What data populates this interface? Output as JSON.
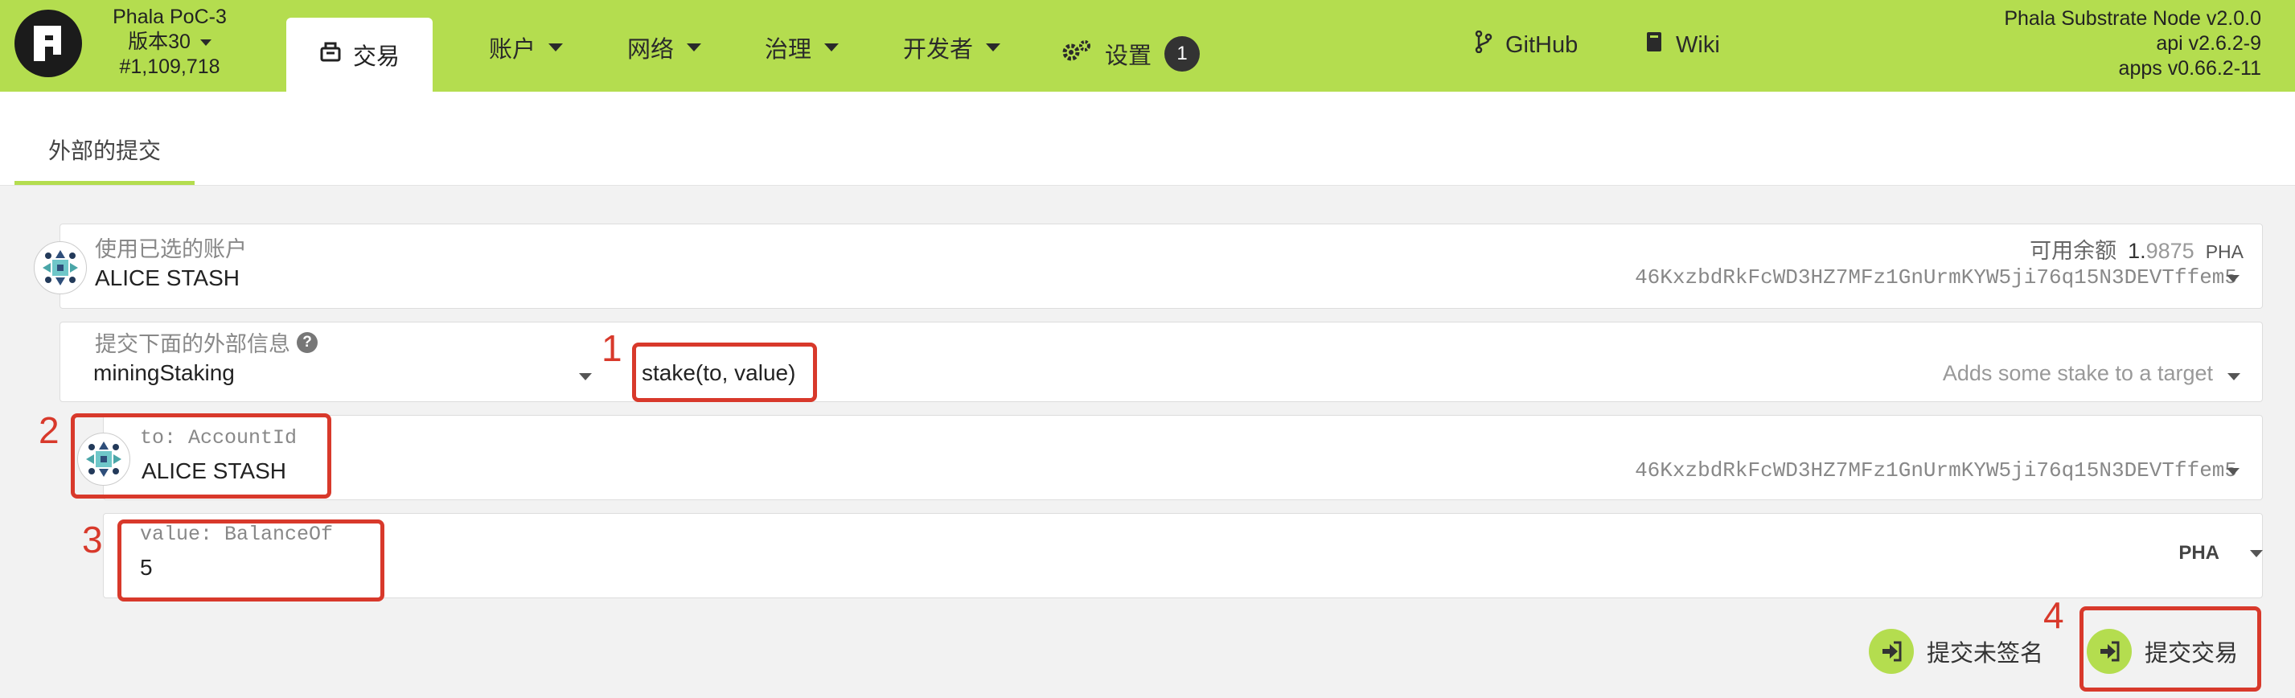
{
  "nav": {
    "chain_name": "Phala PoC-3",
    "chain_version": "版本30",
    "block_number": "#1,109,718",
    "active_tab": "交易",
    "menu": [
      {
        "label": "账户"
      },
      {
        "label": "网络"
      },
      {
        "label": "治理"
      },
      {
        "label": "开发者"
      }
    ],
    "settings_label": "设置",
    "settings_badge": "1",
    "github_label": "GitHub",
    "wiki_label": "Wiki",
    "node_name": "Phala Substrate Node v2.0.0",
    "api_version": "api v2.6.2-9",
    "apps_version": "apps v0.66.2-11",
    "accent_color": "#b4dd4f"
  },
  "subnav": {
    "tab_label": "外部的提交"
  },
  "account": {
    "label": "使用已选的账户",
    "name": "ALICE STASH",
    "balance_label": "可用余额",
    "balance_int": "1.",
    "balance_dec": "9875",
    "balance_unit": "PHA",
    "address": "46KxzbdRkFcWD3HZ7MFz1GnUrmKYW5ji76q15N3DEVTffem5"
  },
  "extrinsic": {
    "label": "提交下面的外部信息",
    "module": "miningStaking",
    "method": "stake(to, value)",
    "method_desc": "Adds some stake to a target"
  },
  "param_to": {
    "label": "to: AccountId",
    "name": "ALICE STASH",
    "address": "46KxzbdRkFcWD3HZ7MFz1GnUrmKYW5ji76q15N3DEVTffem5"
  },
  "param_value": {
    "label": "value: BalanceOf",
    "value": "5",
    "unit": "PHA"
  },
  "actions": {
    "unsigned_label": "提交未签名",
    "submit_label": "提交交易"
  },
  "annotations": {
    "n1": "1",
    "n2": "2",
    "n3": "3",
    "n4": "4",
    "color": "#d8392b"
  }
}
